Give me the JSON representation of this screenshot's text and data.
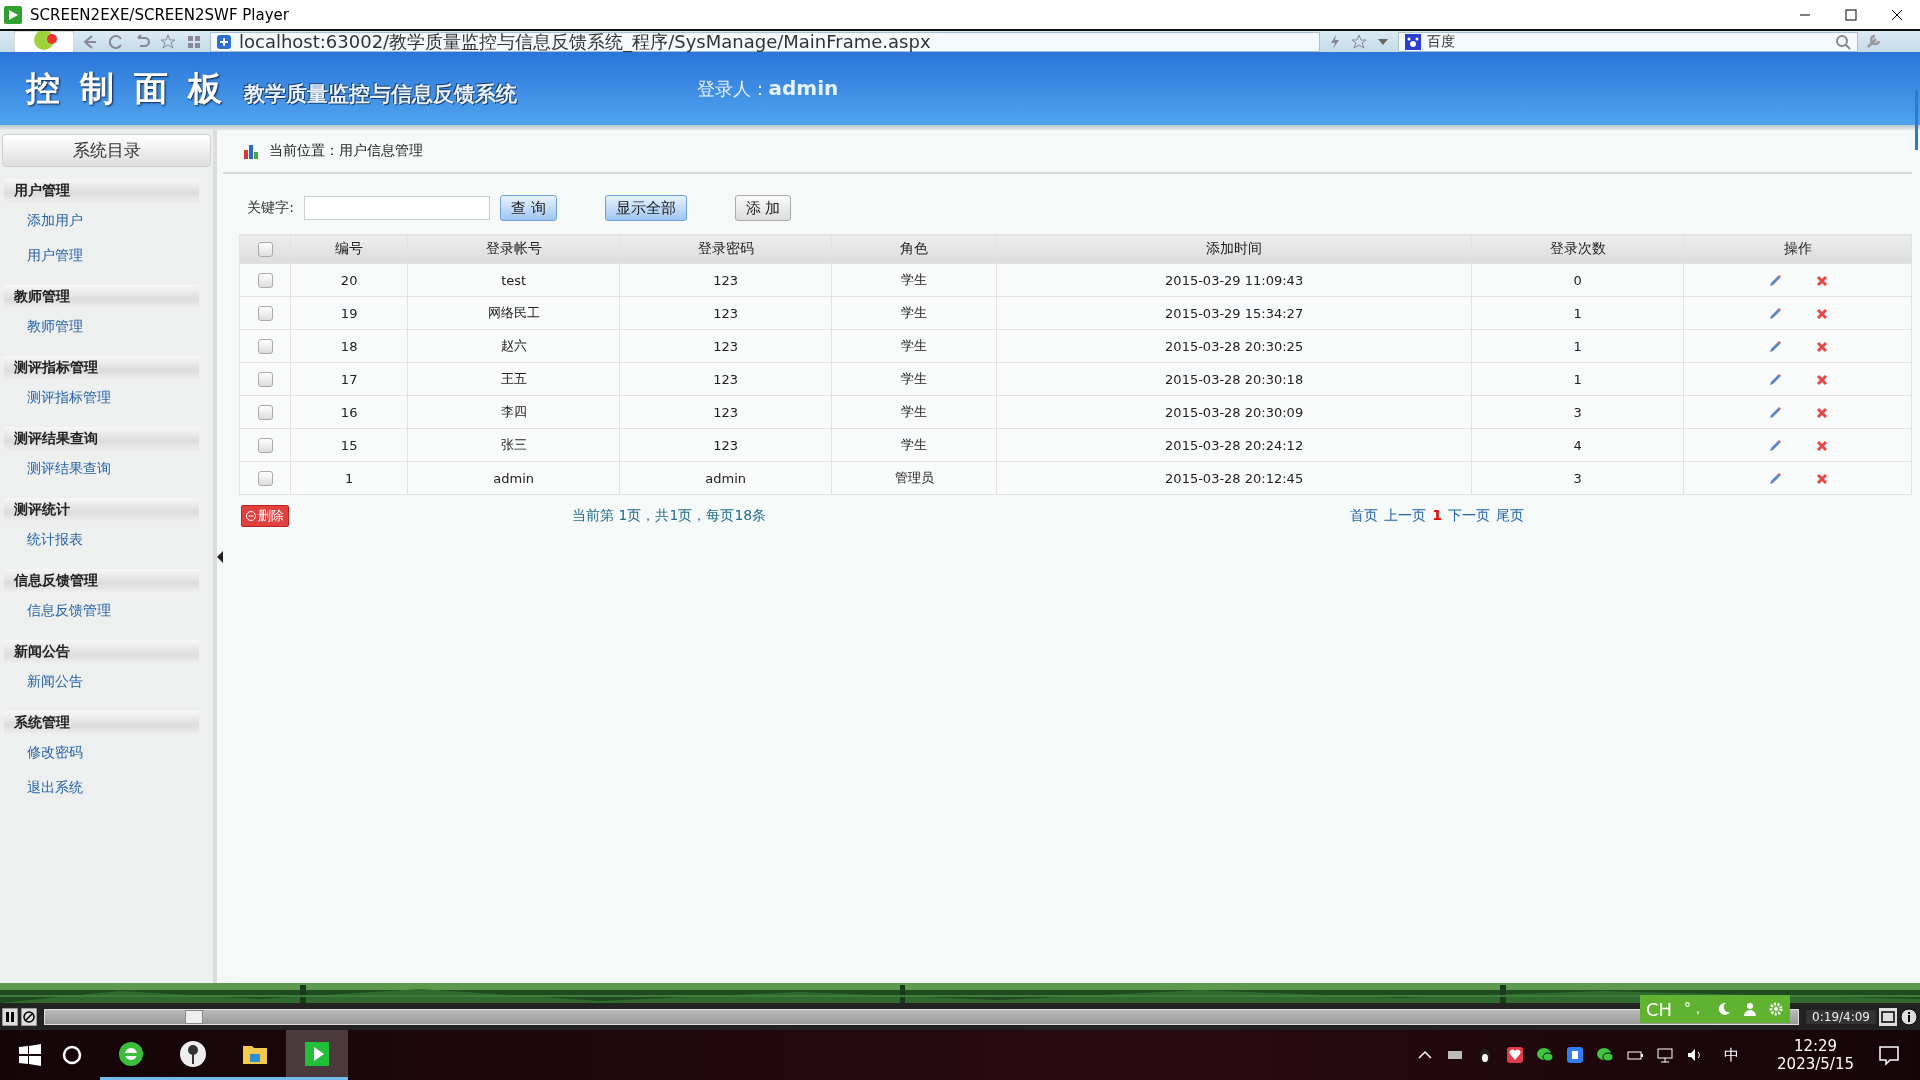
{
  "player": {
    "title": "SCREEN2EXE/SCREEN2SWF Player"
  },
  "browser": {
    "url": "localhost:63002/教学质量监控与信息反馈系统_程序/SysManage/MainFrame.aspx",
    "search_engine": "百度"
  },
  "header": {
    "title": "控 制 面 板",
    "subtitle": "教学质量监控与信息反馈系统",
    "user_label": "登录人：",
    "user": "admin"
  },
  "sidebar": {
    "title": "系统目录",
    "groups": [
      {
        "label": "用户管理",
        "items": [
          {
            "label": "添加用户"
          },
          {
            "label": "用户管理"
          }
        ]
      },
      {
        "label": "教师管理",
        "items": [
          {
            "label": "教师管理"
          }
        ]
      },
      {
        "label": "测评指标管理",
        "items": [
          {
            "label": "测评指标管理"
          }
        ]
      },
      {
        "label": "测评结果查询",
        "items": [
          {
            "label": "测评结果查询"
          }
        ]
      },
      {
        "label": "测评统计",
        "items": [
          {
            "label": "统计报表"
          }
        ]
      },
      {
        "label": "信息反馈管理",
        "items": [
          {
            "label": "信息反馈管理"
          }
        ]
      },
      {
        "label": "新闻公告",
        "items": [
          {
            "label": "新闻公告"
          }
        ]
      },
      {
        "label": "系统管理",
        "items": [
          {
            "label": "修改密码"
          },
          {
            "label": "退出系统"
          }
        ]
      }
    ]
  },
  "breadcrumb": "当前位置：用户信息管理",
  "search": {
    "label": "关键字:",
    "buttons": [
      {
        "label": "查 询",
        "kind": "blue"
      },
      {
        "label": "显示全部",
        "kind": "blue"
      },
      {
        "label": "添 加",
        "kind": "gray"
      }
    ]
  },
  "table": {
    "select_all": false,
    "columns": [
      "编号",
      "登录帐号",
      "登录密码",
      "角色",
      "添加时间",
      "登录次数",
      "操作"
    ],
    "rows": [
      {
        "checked": false,
        "cells": [
          "20",
          "test",
          "123",
          "学生",
          "2015-03-29 11:09:43",
          "0"
        ]
      },
      {
        "checked": false,
        "cells": [
          "19",
          "网络民工",
          "123",
          "学生",
          "2015-03-29 15:34:27",
          "1"
        ]
      },
      {
        "checked": false,
        "cells": [
          "18",
          "赵六",
          "123",
          "学生",
          "2015-03-28 20:30:25",
          "1"
        ]
      },
      {
        "checked": false,
        "cells": [
          "17",
          "王五",
          "123",
          "学生",
          "2015-03-28 20:30:18",
          "1"
        ]
      },
      {
        "checked": false,
        "cells": [
          "16",
          "李四",
          "123",
          "学生",
          "2015-03-28 20:30:09",
          "3"
        ]
      },
      {
        "checked": false,
        "cells": [
          "15",
          "张三",
          "123",
          "学生",
          "2015-03-28 20:24:12",
          "4"
        ]
      },
      {
        "checked": false,
        "cells": [
          "1",
          "admin",
          "admin",
          "管理员",
          "2015-03-28 20:12:45",
          "3"
        ]
      }
    ]
  },
  "delete_button": "删除",
  "page_info": "当前第 1页，共1页，每页18条",
  "pagination": [
    {
      "label": "首页",
      "selected": false
    },
    {
      "label": "上一页",
      "selected": false
    },
    {
      "label": "1",
      "selected": true
    },
    {
      "label": "下一页",
      "selected": false
    },
    {
      "label": "尾页",
      "selected": false
    }
  ],
  "player_controls": {
    "level": 0.08,
    "time": "0:19/4:09"
  },
  "ime": {
    "mode": "CH",
    "punct": "°，"
  },
  "taskbar": {
    "ime": "中",
    "time": "12:29",
    "date": "2023/5/15"
  }
}
